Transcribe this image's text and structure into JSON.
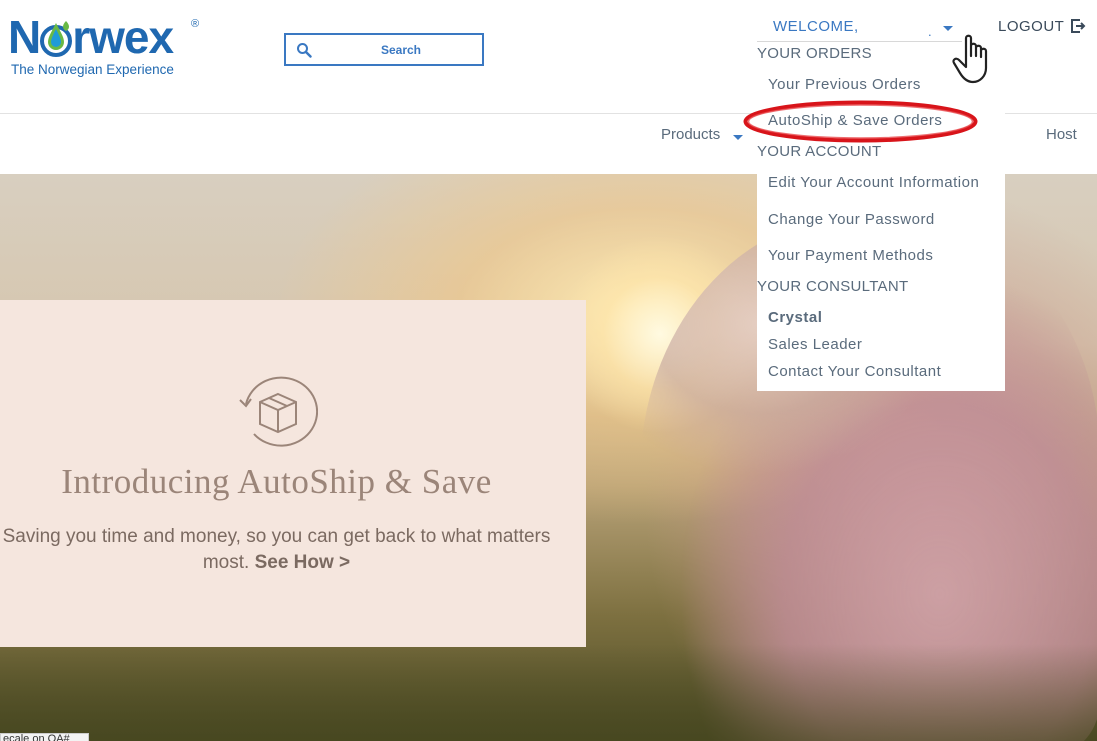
{
  "brand": {
    "name_pre": "N",
    "name_post": "rwex",
    "registered": "®",
    "tagline": "The Norwegian Experience"
  },
  "search": {
    "placeholder": "Search"
  },
  "account": {
    "welcome": "WELCOME,",
    "name_mask": ".",
    "logout": "LOGOUT"
  },
  "nav": {
    "products": "Products",
    "host": "Host"
  },
  "menu": {
    "orders_heading": "YOUR ORDERS",
    "previous_orders": "Your Previous Orders",
    "autoship_orders": "AutoShip & Save Orders",
    "account_heading": "YOUR ACCOUNT",
    "edit_account": "Edit Your Account Information",
    "change_password": "Change Your Password",
    "payment_methods": "Your Payment Methods",
    "consultant_heading": "YOUR CONSULTANT",
    "consultant_name": "Crystal",
    "consultant_role": "Sales Leader",
    "contact_consultant": "Contact Your Consultant"
  },
  "promo": {
    "title": "Introducing AutoShip & Save",
    "text": "Saving you time and money, so you can get back to what matters most.",
    "link": "See How >"
  },
  "footer": {
    "tag": "ecale on OA#"
  },
  "colors": {
    "brand_blue": "#1f68b0",
    "brand_green": "#69b945",
    "link_blue": "#3a78c2",
    "menu_text": "#5a6b7c",
    "promo_bg": "#f5e6de",
    "highlight_red": "#d8141a"
  },
  "icons": {
    "search": "search-icon",
    "logout": "logout-icon",
    "box": "autoship-box-icon",
    "cursor": "hand-cursor-icon"
  }
}
